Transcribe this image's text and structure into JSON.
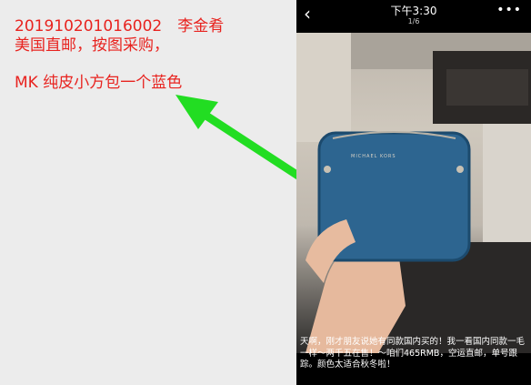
{
  "note": {
    "line1": "201910201016002　李金肴",
    "line2": "美国直邮，按图采购，",
    "line3": "MK 纯皮小方包一个蓝色"
  },
  "phone": {
    "time": "下午3:30",
    "counter": "1/6",
    "more": "•••",
    "caption": "天啊，刚才朋友说她有同款国内买的！我一看国内同款一毛一样～两千五在售！～咱们465RMB，空运直邮，单号跟踪。颜色太适合秋冬啦！",
    "bag_logo": "MICHAEL KORS"
  },
  "colors": {
    "note_text": "#e8231f",
    "arrow": "#22dd22",
    "bag": "#2d6590"
  }
}
